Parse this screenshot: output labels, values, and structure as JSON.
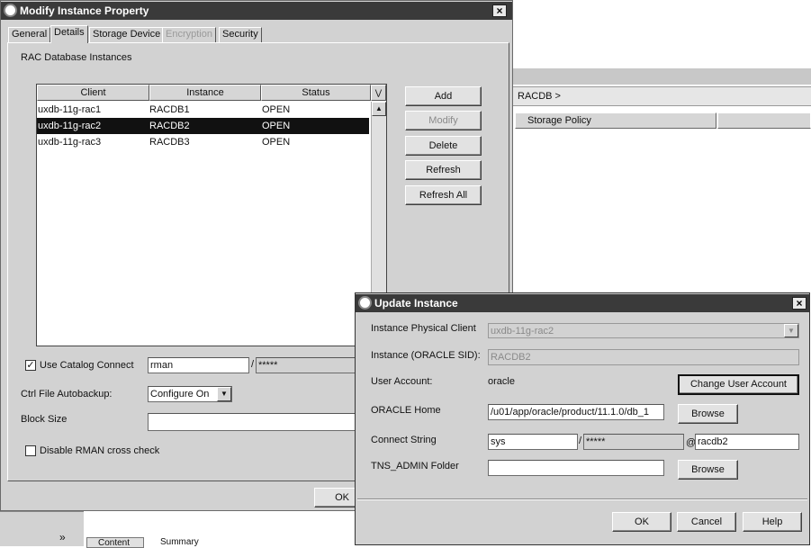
{
  "background": {
    "breadcrumb": "RACDB  >",
    "storage_policy_header": "Storage Policy",
    "bottom_tab_content": "Content",
    "bottom_tab_summary": "Summary",
    "chevron": "»"
  },
  "modify_dialog": {
    "title": "Modify Instance Property",
    "close": "×",
    "tabs": [
      "General",
      "Details",
      "Storage Device",
      "Encryption",
      "Security"
    ],
    "section_title": "RAC Database Instances",
    "table": {
      "columns": [
        "Client",
        "Instance",
        "Status"
      ],
      "rows": [
        [
          "uxdb-11g-rac1",
          "RACDB1",
          "OPEN"
        ],
        [
          "uxdb-11g-rac2",
          "RACDB2",
          "OPEN"
        ],
        [
          "uxdb-11g-rac3",
          "RACDB3",
          "OPEN"
        ]
      ],
      "selected_row_index": 1
    },
    "buttons": {
      "add": "Add",
      "modify": "Modify",
      "delete": "Delete",
      "refresh": "Refresh",
      "refresh_all": "Refresh All",
      "ok": "OK"
    },
    "use_catalog_connect_label": "Use Catalog Connect",
    "use_catalog_connect_checked": "✓",
    "catalog_user": "rman",
    "catalog_sep": "/",
    "catalog_password": "*****",
    "ctrl_file_label": "Ctrl File Autobackup:",
    "ctrl_file_value": "Configure On",
    "block_size_label": "Block Size",
    "block_size_value": "",
    "disable_rman_label": "Disable RMAN cross check"
  },
  "update_dialog": {
    "title": "Update Instance",
    "close": "×",
    "physical_client_label": "Instance Physical Client",
    "physical_client_value": "uxdb-11g-rac2",
    "instance_sid_label": "Instance (ORACLE SID):",
    "instance_sid_value": "RACDB2",
    "user_account_label": "User Account:",
    "user_account_value": "oracle",
    "change_user_button": "Change User Account",
    "oracle_home_label": "ORACLE Home",
    "oracle_home_value": "/u01/app/oracle/product/11.1.0/db_1",
    "browse_label": "Browse",
    "connect_string_label": "Connect String",
    "connect_user": "sys",
    "connect_sep": "/",
    "connect_password": "*****",
    "connect_at": "@",
    "connect_service": "racdb2",
    "tns_admin_label": "TNS_ADMIN Folder",
    "tns_admin_value": "",
    "browse2_label": "Browse",
    "ok": "OK",
    "cancel": "Cancel",
    "help": "Help"
  }
}
